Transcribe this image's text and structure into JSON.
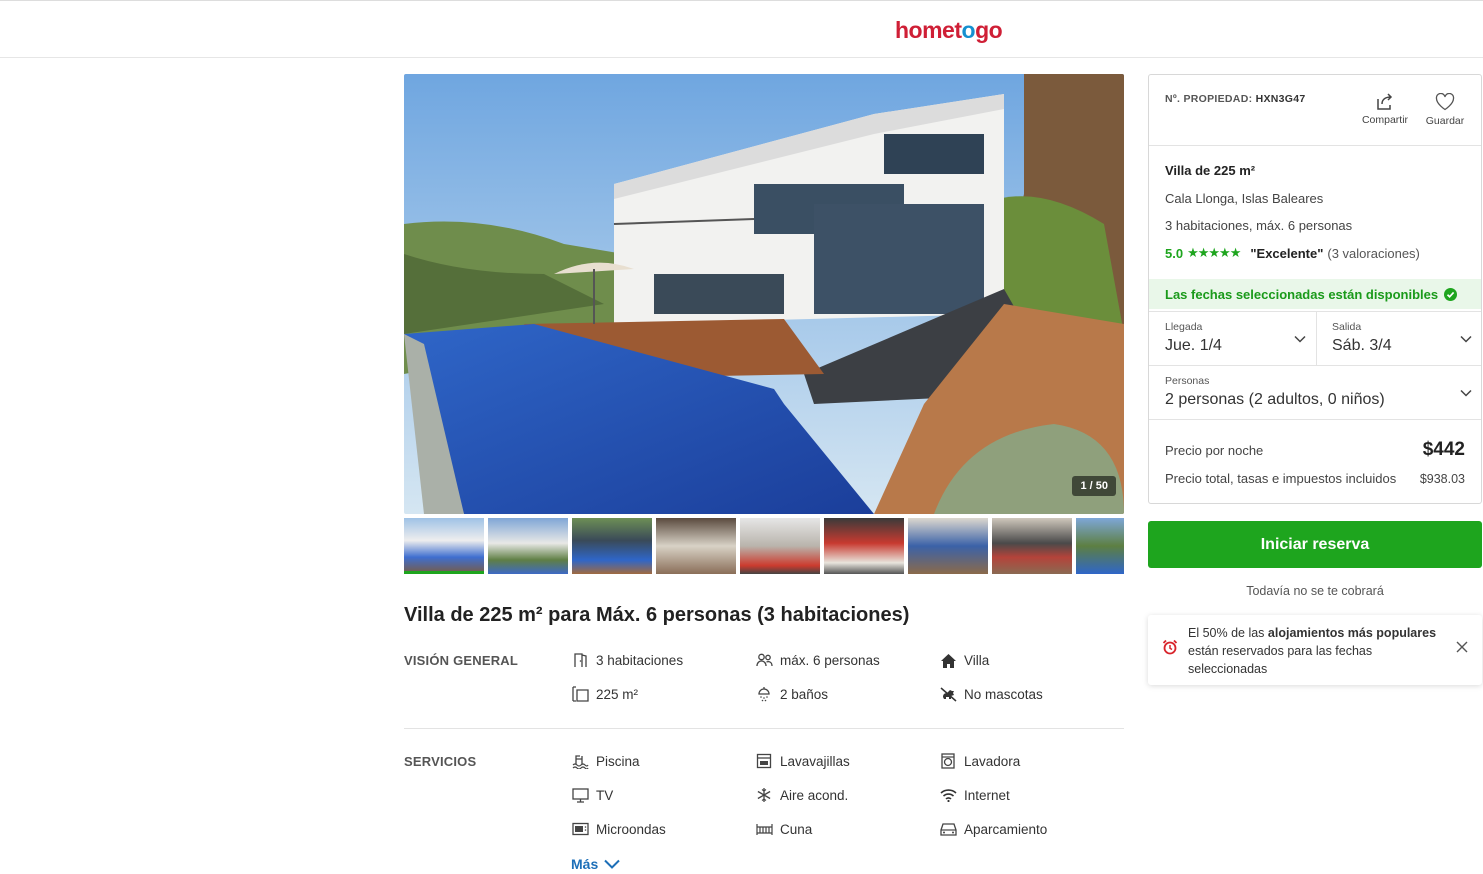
{
  "header": {
    "logo_part1": "home",
    "logo_part2": "t",
    "logo_pin": "o",
    "logo_part3": "go"
  },
  "gallery": {
    "counter": "1 / 50",
    "thumb_count": 9
  },
  "listing": {
    "title": "Villa de 225 m² para Máx. 6 personas (3 habitaciones)"
  },
  "overview": {
    "label": "VISIÓN GENERAL",
    "items": [
      {
        "icon": "bedroom-icon",
        "text": "3 habitaciones"
      },
      {
        "icon": "people-icon",
        "text": "máx. 6 personas"
      },
      {
        "icon": "house-icon",
        "text": "Villa"
      },
      {
        "icon": "area-icon",
        "text": "225 m²"
      },
      {
        "icon": "shower-icon",
        "text": "2 baños"
      },
      {
        "icon": "no-pets-icon",
        "text": "No mascotas"
      }
    ]
  },
  "services": {
    "label": "SERVICIOS",
    "items": [
      {
        "icon": "pool-icon",
        "text": "Piscina"
      },
      {
        "icon": "dishwasher-icon",
        "text": "Lavavajillas"
      },
      {
        "icon": "washer-icon",
        "text": "Lavadora"
      },
      {
        "icon": "tv-icon",
        "text": "TV"
      },
      {
        "icon": "snowflake-icon",
        "text": "Aire acond."
      },
      {
        "icon": "wifi-icon",
        "text": "Internet"
      },
      {
        "icon": "microwave-icon",
        "text": "Microondas"
      },
      {
        "icon": "crib-icon",
        "text": "Cuna"
      },
      {
        "icon": "car-icon",
        "text": "Aparcamiento"
      }
    ],
    "more_label": "Más"
  },
  "panel": {
    "property_label": "Nº. PROPIEDAD:",
    "property_code": "HXN3G47",
    "share_label": "Compartir",
    "save_label": "Guardar",
    "villa_title": "Villa de 225 m²",
    "location": "Cala Llonga, Islas Baleares",
    "rooms": "3 habitaciones, máx. 6 personas",
    "rating_score": "5.0",
    "rating_stars": 5,
    "rating_label": "\"Excelente\"",
    "rating_count": "(3 valoraciones)",
    "availability": "Las fechas seleccionadas están disponibles",
    "arrival_label": "Llegada",
    "arrival_value": "Jue. 1/4",
    "departure_label": "Salida",
    "departure_value": "Sáb. 3/4",
    "guests_label": "Personas",
    "guests_value": "2 personas (2 adultos, 0 niños)",
    "price_night_label": "Precio por noche",
    "price_night": "$442",
    "price_total_label": "Precio total, tasas e impuestos incluidos",
    "price_total": "$938.03"
  },
  "cta": {
    "label": "Iniciar reserva",
    "note": "Todavía no se te cobrará"
  },
  "notice": {
    "text_pre": "El 50% de las ",
    "text_bold": "alojamientos más populares",
    "text_post": " están reservados para las fechas seleccionadas"
  },
  "colors": {
    "brand_red": "#cf1f36",
    "brand_blue": "#1590d0",
    "accent_green": "#1ea51e",
    "link_blue": "#1d6fb8"
  }
}
